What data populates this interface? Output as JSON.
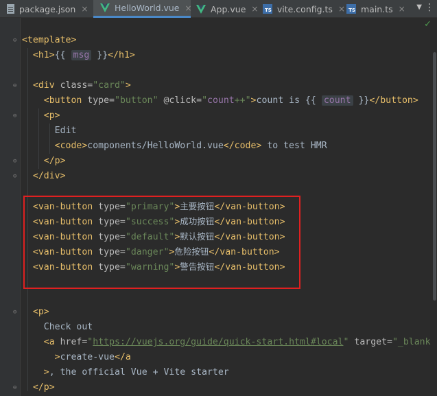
{
  "tabs": [
    {
      "label": "package.json",
      "icon": "json-file-icon",
      "close": "×"
    },
    {
      "label": "HelloWorld.vue",
      "icon": "vue-file-icon",
      "close": "×",
      "active": true
    },
    {
      "label": "App.vue",
      "icon": "vue-file-icon",
      "close": "×"
    },
    {
      "label": "vite.config.ts",
      "icon": "ts-file-icon",
      "close": "×",
      "badge": "TS"
    },
    {
      "label": "main.ts",
      "icon": "ts-file-icon",
      "close": "×",
      "badge": "TS"
    }
  ],
  "tabbar": {
    "more": "▼",
    "menu": "⋮"
  },
  "editor": {
    "check_mark": "✓",
    "tokens": {
      "template_open": "<template>",
      "h1_open": "<h1>",
      "lbrace": "{{",
      "rbrace": "}}",
      "msg": "msg",
      "h1_close": "</h1>",
      "div_open": "<div ",
      "class_attr": "class=",
      "card_val": "\"card\"",
      "gt": ">",
      "button_open": "<button ",
      "type_attr": "type=",
      "button_val": "\"button\"",
      "click_attr": " @click=",
      "click_q1": "\"",
      "click_count": "count",
      "click_rest": "++\"",
      "count_is": "count is ",
      "count": "count",
      "button_close": "</button>",
      "p_open": "<p>",
      "edit": "Edit",
      "code_open": "<code>",
      "code_text": "components/HelloWorld.vue",
      "code_close": "</code>",
      "to_test": " to test HMR",
      "p_close": "</p>",
      "div_close": "</div>",
      "van_open": "<van-button ",
      "van_close": "</van-button>",
      "check_out": "Check out",
      "a_open": "<a ",
      "href_attr": "href=",
      "q": "\"",
      "href_url": "https://vuejs.org/guide/quick-start.html#local",
      "target_attr": " target=",
      "target_val": "\"_blank",
      "create_vue": "create-vue",
      "a_close": "</a",
      "official": ", the official Vue + Vite starter"
    },
    "van_buttons": [
      {
        "type": "\"primary\"",
        "label": "主要按钮"
      },
      {
        "type": "\"success\"",
        "label": "成功按钮"
      },
      {
        "type": "\"default\"",
        "label": "默认按钮"
      },
      {
        "type": "\"danger\"",
        "label": "危险按钮"
      },
      {
        "type": "\"warning\"",
        "label": "警告按钮"
      }
    ]
  }
}
